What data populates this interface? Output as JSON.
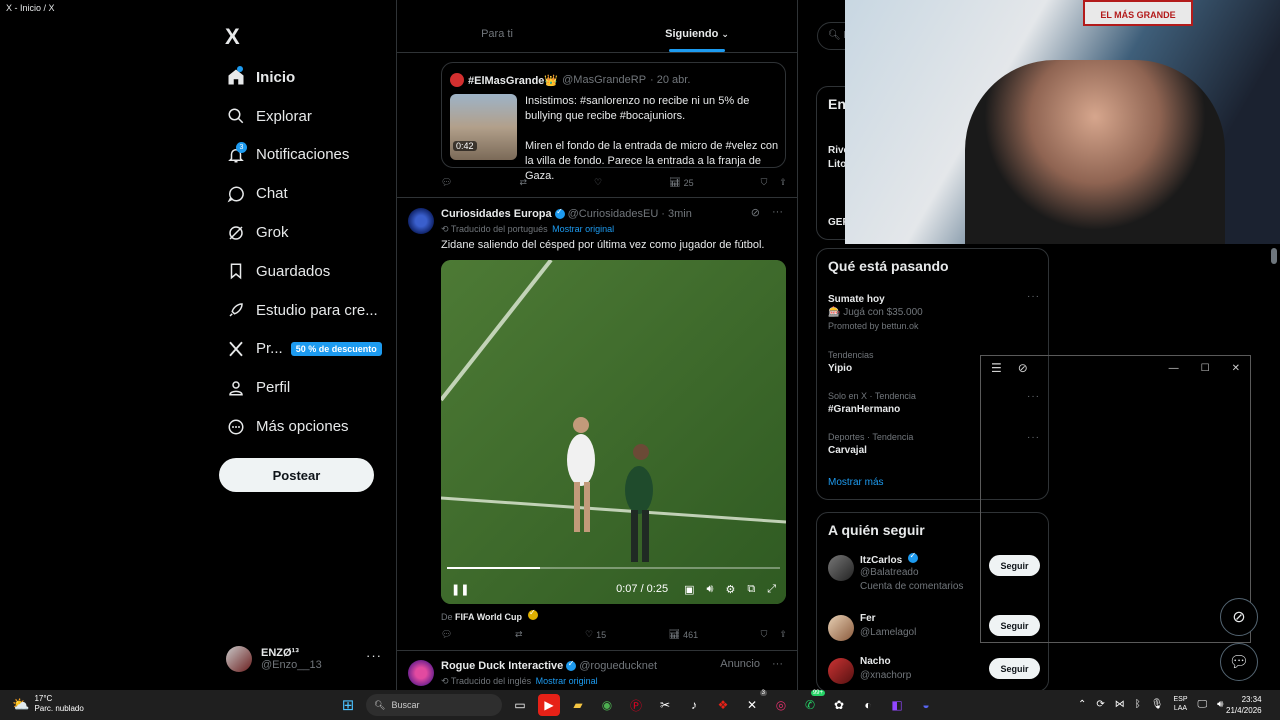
{
  "window": {
    "title": "X - Inicio / X"
  },
  "sidebar": {
    "logo": "X",
    "items": [
      {
        "label": "Inicio",
        "icon": "home-icon",
        "active": true
      },
      {
        "label": "Explorar",
        "icon": "search-icon"
      },
      {
        "label": "Notificaciones",
        "icon": "bell-icon",
        "badge": "3"
      },
      {
        "label": "Chat",
        "icon": "chat-icon"
      },
      {
        "label": "Grok",
        "icon": "grok-icon"
      },
      {
        "label": "Guardados",
        "icon": "bookmark-icon"
      },
      {
        "label": "Estudio para cre...",
        "icon": "rocket-icon"
      },
      {
        "label": "Pr...",
        "icon": "x-premium-icon",
        "promo": "50 % de descuento"
      },
      {
        "label": "Perfil",
        "icon": "person-icon"
      },
      {
        "label": "Más opciones",
        "icon": "more-circle-icon"
      }
    ],
    "post_button": "Postear",
    "account": {
      "name": "ENZØ¹³",
      "handle": "@Enzo__13"
    }
  },
  "timeline": {
    "tabs": [
      "Para ti",
      "Siguiendo"
    ],
    "active_tab": "Siguiendo",
    "quote": {
      "name": "#ElMasGrande👑",
      "handle": "@MasGrandeRP",
      "time": "· 20 abr.",
      "duration": "0:42",
      "text": "Insistimos: #sanlorenzo no recibe ni un 5% de bullying que recibe #bocajuniors.\n\nMiren el fondo de la entrada de micro de #velez con la villa de fondo. Parece la entrada a la franja de Gaza."
    },
    "actions1": {
      "views": "25"
    },
    "tweet2": {
      "name": "Curiosidades Europa",
      "handle": "@CuriosidadesEU",
      "time": "· 3min",
      "translated": "Traducido del portugués",
      "show_original": "Mostrar original",
      "text": "Zidane saliendo del césped por última vez como jugador de fútbol.",
      "video_time": "0:07 / 0:25",
      "video_progress": 0.28,
      "from_prefix": "De",
      "from_name": "FIFA World Cup",
      "likes": "15",
      "views": "461"
    },
    "tweet3": {
      "name": "Rogue Duck Interactive",
      "handle": "@rogueducknet",
      "tag": "Anuncio",
      "translated": "Traducido del inglés",
      "show_original": "Mostrar original"
    }
  },
  "right": {
    "search_placeholder": "B",
    "partial_panel": {
      "title": "En",
      "lines": [
        "Rive",
        "Lito",
        "GEF"
      ]
    },
    "trends_title": "Qué está pasando",
    "trends": [
      {
        "category": "",
        "title": "Sumate hoy",
        "sub": "🎰 Jugá con $35.000",
        "promo": "Promoted by bettun.ok"
      },
      {
        "category": "Tendencias",
        "title": "Yipio"
      },
      {
        "category": "Solo en X · Tendencia",
        "title": "#GranHermano"
      },
      {
        "category": "Deportes · Tendencia",
        "title": "Carvajal"
      }
    ],
    "show_more": "Mostrar más",
    "follow_title": "A quién seguir",
    "follow": [
      {
        "name": "ItzCarlos",
        "handle": "@Balatreado",
        "note": "Cuenta de comentarios",
        "button": "Seguir"
      },
      {
        "name": "Fer",
        "handle": "@Lamelagol",
        "button": "Seguir"
      },
      {
        "name": "Nacho",
        "handle": "@xnachorp",
        "button": "Seguir"
      }
    ]
  },
  "webcam": {
    "banner": "EL MÁS GRANDE"
  },
  "taskbar": {
    "weather": {
      "temp": "17°C",
      "desc": "Parc. nublado"
    },
    "search": "Buscar",
    "whatsapp_badge": "99+",
    "x_badge": "3",
    "lang": "ESP",
    "lang2": "LAA",
    "time": "23:34",
    "date": "21/4/2026"
  }
}
